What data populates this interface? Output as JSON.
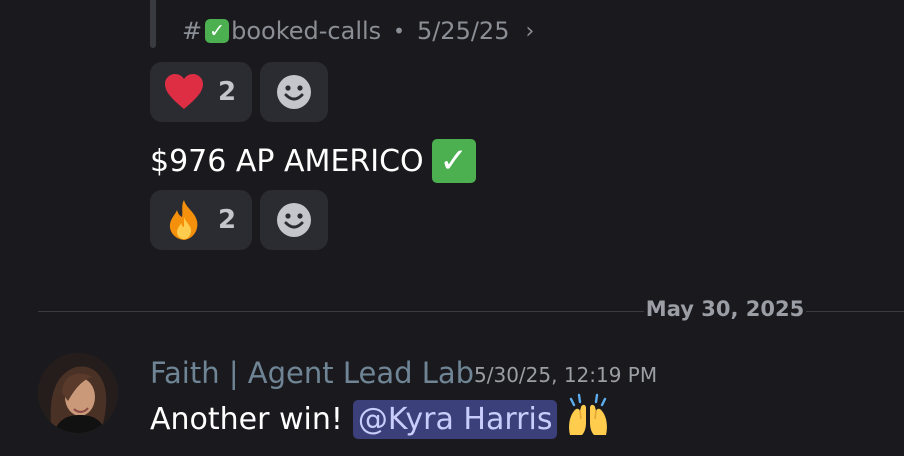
{
  "forwarded_reference": {
    "hash": "#",
    "channel_name": "booked-calls",
    "separator": "•",
    "date": "5/25/25",
    "chevron": "›"
  },
  "reactions_first": {
    "emoji_name": "red-heart",
    "count": "2"
  },
  "message_one": {
    "text": "$976 AP AMERICO",
    "emoji_name": "white-check-mark",
    "check_glyph": "✓"
  },
  "reactions_second": {
    "emoji_name": "fire",
    "count": "2"
  },
  "date_divider": {
    "label": "May 30, 2025"
  },
  "message_two": {
    "author": "Faith | Agent Lead Lab",
    "timestamp": "5/30/25, 12:19 PM",
    "text": "Another win!",
    "mention": "@Kyra Harris",
    "emoji_name": "raising-hands"
  },
  "colors": {
    "background": "#1a1a1e",
    "reaction_bg": "#2b2c31",
    "mention_bg": "#3b3f7a",
    "author": "#6f8595",
    "check_green": "#4caf50"
  }
}
